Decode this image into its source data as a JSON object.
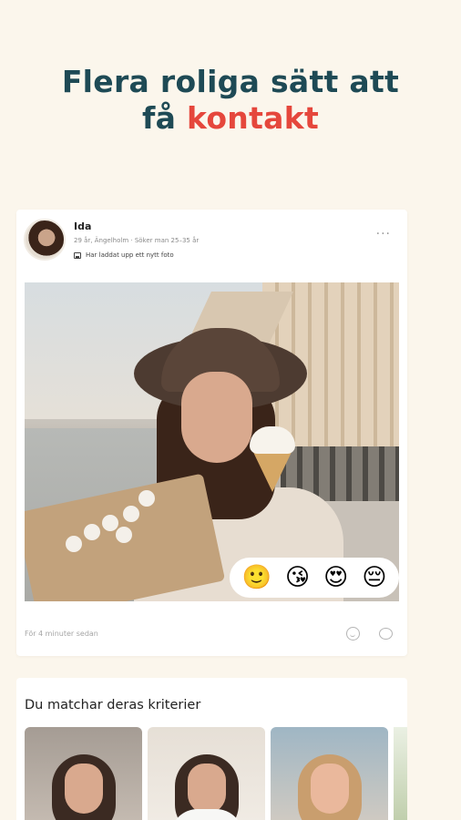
{
  "headline": {
    "line1": "Flera roliga sätt att",
    "line2_prefix": "få ",
    "line2_accent": "kontakt"
  },
  "colors": {
    "background": "#fbf6ec",
    "headline": "#1e4a55",
    "accent": "#e5473c"
  },
  "post": {
    "user_name": "Ida",
    "user_meta": "29 år, Ängelholm · Söker man 25–35 år",
    "activity_text": "Har laddat upp ett nytt foto",
    "more_icon": "more-horizontal-icon",
    "reactions": [
      "🙂",
      "😘",
      "😍",
      "😔"
    ],
    "timestamp": "För 4 minuter sedan",
    "action_icons": [
      "smile-icon",
      "comment-icon"
    ]
  },
  "matches": {
    "title": "Du matchar deras kriterier"
  }
}
